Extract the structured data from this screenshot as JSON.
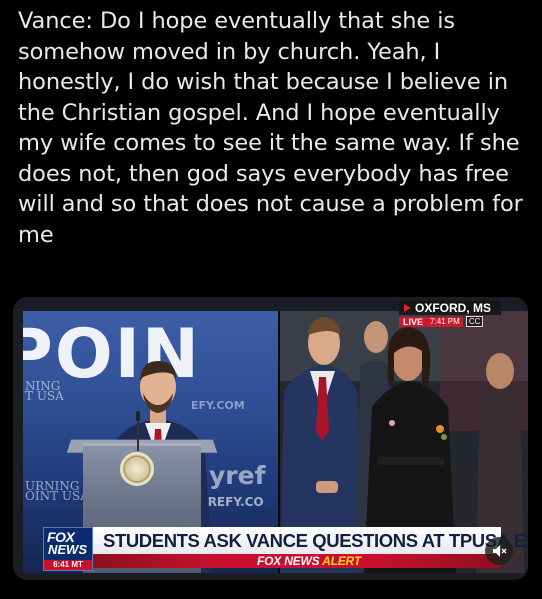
{
  "tweet": {
    "text": "Vance: Do I hope eventually that she is somehow moved in by church. Yeah, I honestly, I do wish that because I believe in the Christian gospel. And I hope eventually my wife comes to see it the same way. If she does not, then god says everybody has free will and so that does not cause a problem for me"
  },
  "video": {
    "location": "OXFORD, MS",
    "live_label": "LIVE",
    "live_time": "7:41 PM",
    "cc_label": "CC",
    "stage_text": "POIN",
    "ghost_left_1": "NING",
    "ghost_left_2": "T USA",
    "ghost_left_3": "URNING",
    "ghost_left_4": "OINT USA",
    "ghost_url": "EFY.COM",
    "brand_text": "yref",
    "brand_url": "YREFY.CO",
    "logo_top": "FOX",
    "logo_mid": "NEWS",
    "logo_time": "6:41 MT",
    "headline": "STUDENTS ASK VANCE QUESTIONS AT TPUSA EVENT",
    "alert_brand": "FOX NEWS",
    "alert_word": "ALERT"
  },
  "icons": {
    "mute": "speaker-muted-icon"
  },
  "colors": {
    "background": "#000000",
    "text": "#e7e9ea",
    "fox_red": "#c8102e",
    "fox_blue": "#0b2b6e",
    "alert_yellow": "#ffd21f"
  }
}
